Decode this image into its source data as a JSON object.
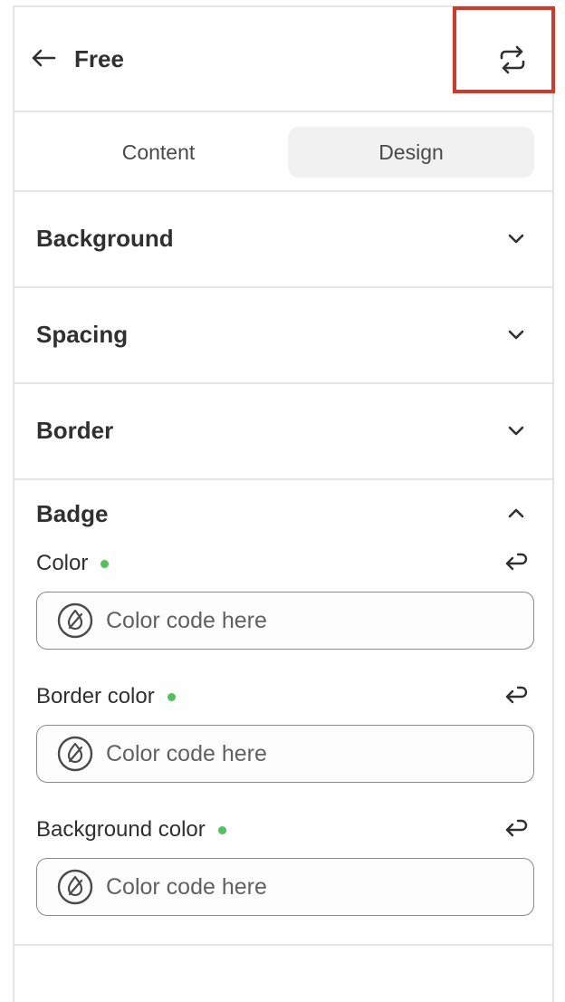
{
  "header": {
    "title": "Free"
  },
  "tabs": [
    {
      "label": "Content"
    },
    {
      "label": "Design"
    }
  ],
  "sections": [
    {
      "label": "Background"
    },
    {
      "label": "Spacing"
    },
    {
      "label": "Border"
    }
  ],
  "badge": {
    "label": "Badge",
    "fields": [
      {
        "label": "Color",
        "placeholder": "Color code here"
      },
      {
        "label": "Border color",
        "placeholder": "Color code here"
      },
      {
        "label": "Background color",
        "placeholder": "Color code here"
      }
    ]
  },
  "colors": {
    "highlight": "#d13a2b",
    "status_dot": "#4fc25a",
    "selected_tab_bg": "#f1f1f1"
  }
}
